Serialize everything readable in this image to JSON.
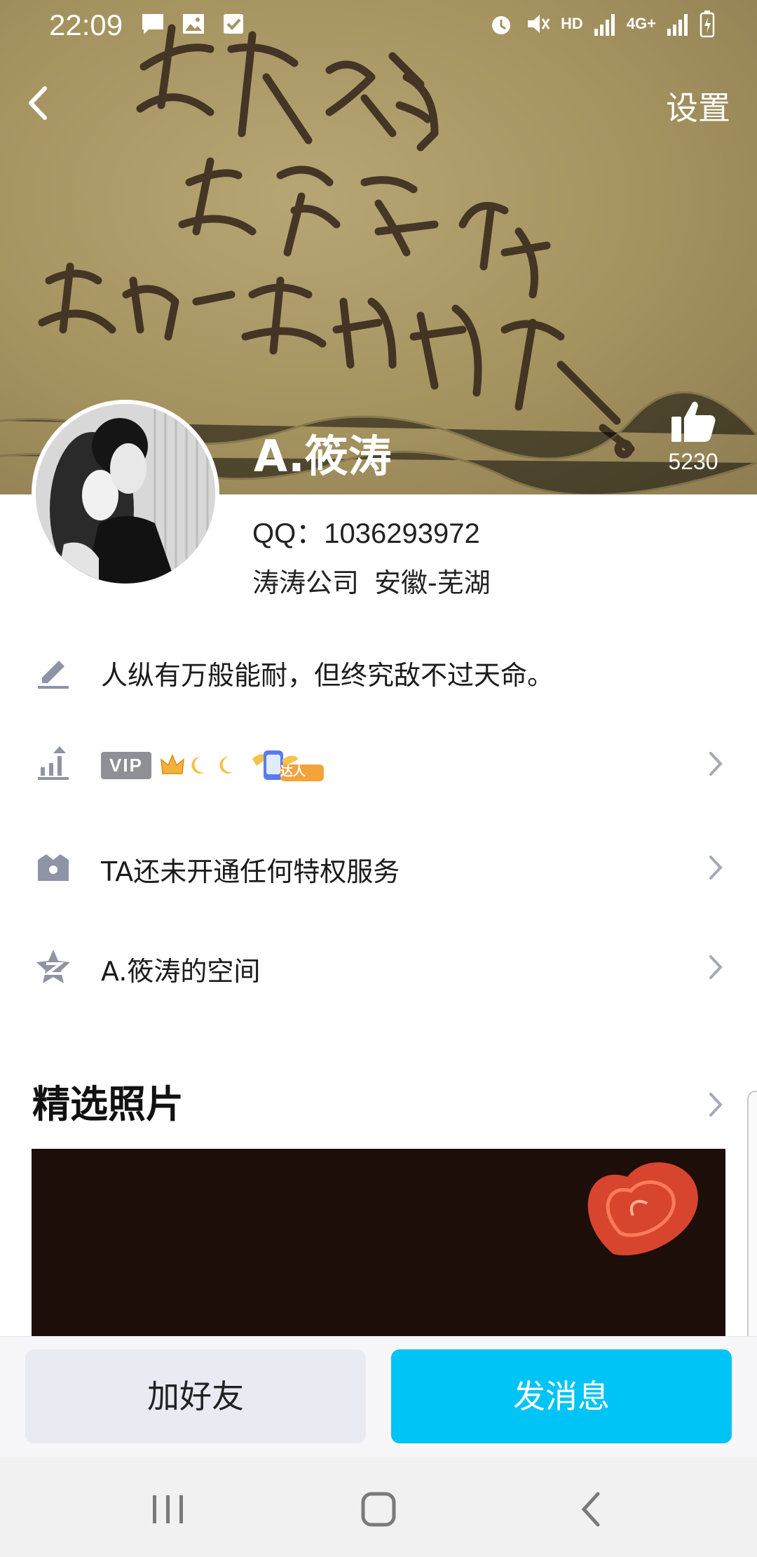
{
  "status_bar": {
    "time": "22:09",
    "left_icons": [
      "message-icon",
      "image-icon",
      "check-icon"
    ],
    "right_icons": [
      "alarm-icon",
      "mute-icon",
      "hd-icon",
      "signal-icon",
      "4g-icon",
      "signal-icon",
      "battery-charging-icon"
    ],
    "hd": "HD",
    "network": "4G+"
  },
  "header": {
    "back_icon": "chevron-left-icon",
    "settings_label": "设置"
  },
  "profile": {
    "name": "A.筱涛",
    "qq": "QQ：1036293972",
    "company": "涛涛公司",
    "location": "安徽-芜湖",
    "like_count": "5230",
    "like_icon": "thumbs-up-icon"
  },
  "rows": {
    "signature": {
      "icon": "pencil-icon",
      "text": "人纵有万般能耐，但终究敌不过天命。"
    },
    "vip": {
      "icon": "level-up-icon",
      "vip_text": "VIP",
      "badge_text": "达人"
    },
    "privilege": {
      "icon": "crown-box-icon",
      "text": "TA还未开通任何特权服务"
    },
    "qzone": {
      "icon": "qzone-star-icon",
      "text": "A.筱涛的空间"
    }
  },
  "photos": {
    "title": "精选照片"
  },
  "actions": {
    "add_friend": "加好友",
    "send_message": "发消息"
  },
  "nav": {
    "items": [
      "recent-apps-icon",
      "home-icon",
      "back-icon"
    ]
  },
  "colors": {
    "accent": "#00c4f5",
    "secondary_button": "#e9ebf3",
    "cover": "#a4925f"
  }
}
